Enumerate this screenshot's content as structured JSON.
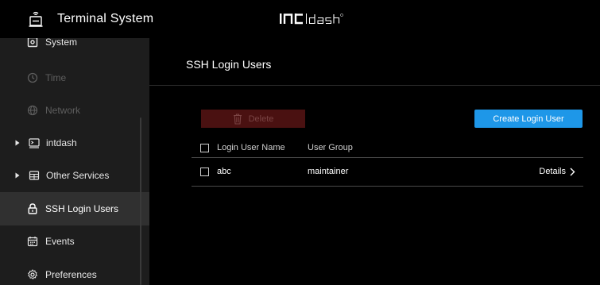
{
  "header": {
    "app_title": "Terminal System",
    "logo_left": "INt",
    "logo_right": "Dash",
    "logo_mark": "®"
  },
  "sidebar": {
    "items": [
      {
        "label": "System",
        "icon": "system-icon",
        "state": "normal"
      },
      {
        "label": "Time",
        "icon": "clock-icon",
        "state": "disabled"
      },
      {
        "label": "Network",
        "icon": "globe-icon",
        "state": "disabled"
      },
      {
        "label": "intdash",
        "icon": "terminal-icon",
        "state": "normal",
        "expandable": true
      },
      {
        "label": "Other Services",
        "icon": "services-icon",
        "state": "normal",
        "expandable": true
      },
      {
        "label": "SSH Login Users",
        "icon": "lock-icon",
        "state": "active"
      },
      {
        "label": "Events",
        "icon": "calendar-icon",
        "state": "normal"
      },
      {
        "label": "Preferences",
        "icon": "gear-icon",
        "state": "normal"
      }
    ]
  },
  "main": {
    "title": "SSH Login Users",
    "delete_label": "Delete",
    "create_label": "Create Login User",
    "table": {
      "columns": [
        "Login User Name",
        "User Group"
      ],
      "rows": [
        {
          "name": "abc",
          "group": "maintainer",
          "action": "Details"
        }
      ]
    }
  },
  "colors": {
    "accent": "#1e97e8",
    "danger_disabled": "#4a1111",
    "sidebar_bg": "#1d1d1d",
    "active_bg": "#303030"
  }
}
